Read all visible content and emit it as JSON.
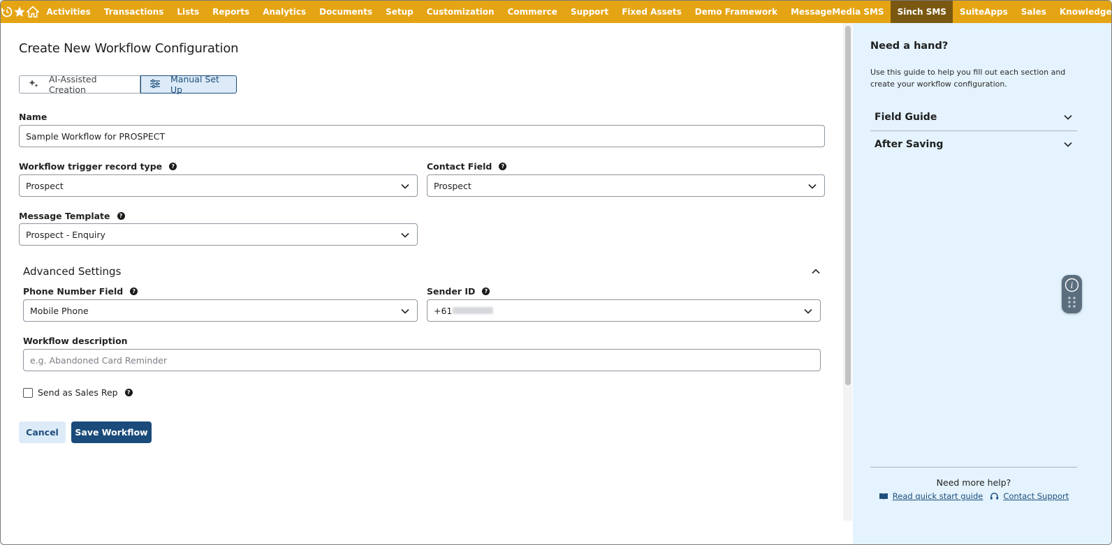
{
  "nav": {
    "items": [
      "Activities",
      "Transactions",
      "Lists",
      "Reports",
      "Analytics",
      "Documents",
      "Setup",
      "Customization",
      "Commerce",
      "Support",
      "Fixed Assets",
      "Demo Framework",
      "MessageMedia SMS",
      "Sinch SMS",
      "SuiteApps",
      "Sales",
      "Knowledge Base"
    ],
    "active": "Sinch SMS"
  },
  "page": {
    "title": "Create New Workflow Configuration",
    "mode_ai": "AI-Assisted Creation",
    "mode_manual": "Manual Set Up"
  },
  "form": {
    "name_label": "Name",
    "name_value": "Sample Workflow for PROSPECT",
    "trigger_label": "Workflow trigger record type",
    "trigger_value": "Prospect",
    "contact_label": "Contact Field",
    "contact_value": "Prospect",
    "template_label": "Message Template",
    "template_value": "Prospect - Enquiry",
    "advanced_title": "Advanced Settings",
    "phone_label": "Phone Number Field",
    "phone_value": "Mobile Phone",
    "sender_label": "Sender ID",
    "sender_prefix": "+61",
    "sender_redacted": "",
    "description_label": "Workflow description",
    "description_placeholder": "e.g. Abandoned Card Reminder",
    "sales_rep_label": "Send as Sales Rep",
    "cancel_label": "Cancel",
    "save_label": "Save Workflow"
  },
  "help": {
    "title": "Need a hand?",
    "description": "Use this guide to help you fill out each section and create your workflow configuration.",
    "accordion": [
      "Field Guide",
      "After Saving"
    ],
    "more_help": "Need more help?",
    "quick_start": "Read quick start guide",
    "contact_support": "Contact Support"
  },
  "colors": {
    "nav_bg": "#e5a413",
    "nav_active": "#7a5811",
    "primary": "#1a4b7a",
    "help_bg": "#e4f3fd"
  },
  "icons": [
    "recent-icon",
    "star-icon",
    "home-icon",
    "sparkle-icon",
    "sliders-icon",
    "question-icon",
    "chevron-down-icon",
    "chevron-up-icon",
    "book-icon",
    "headset-icon",
    "info-icon",
    "grip-icon"
  ]
}
